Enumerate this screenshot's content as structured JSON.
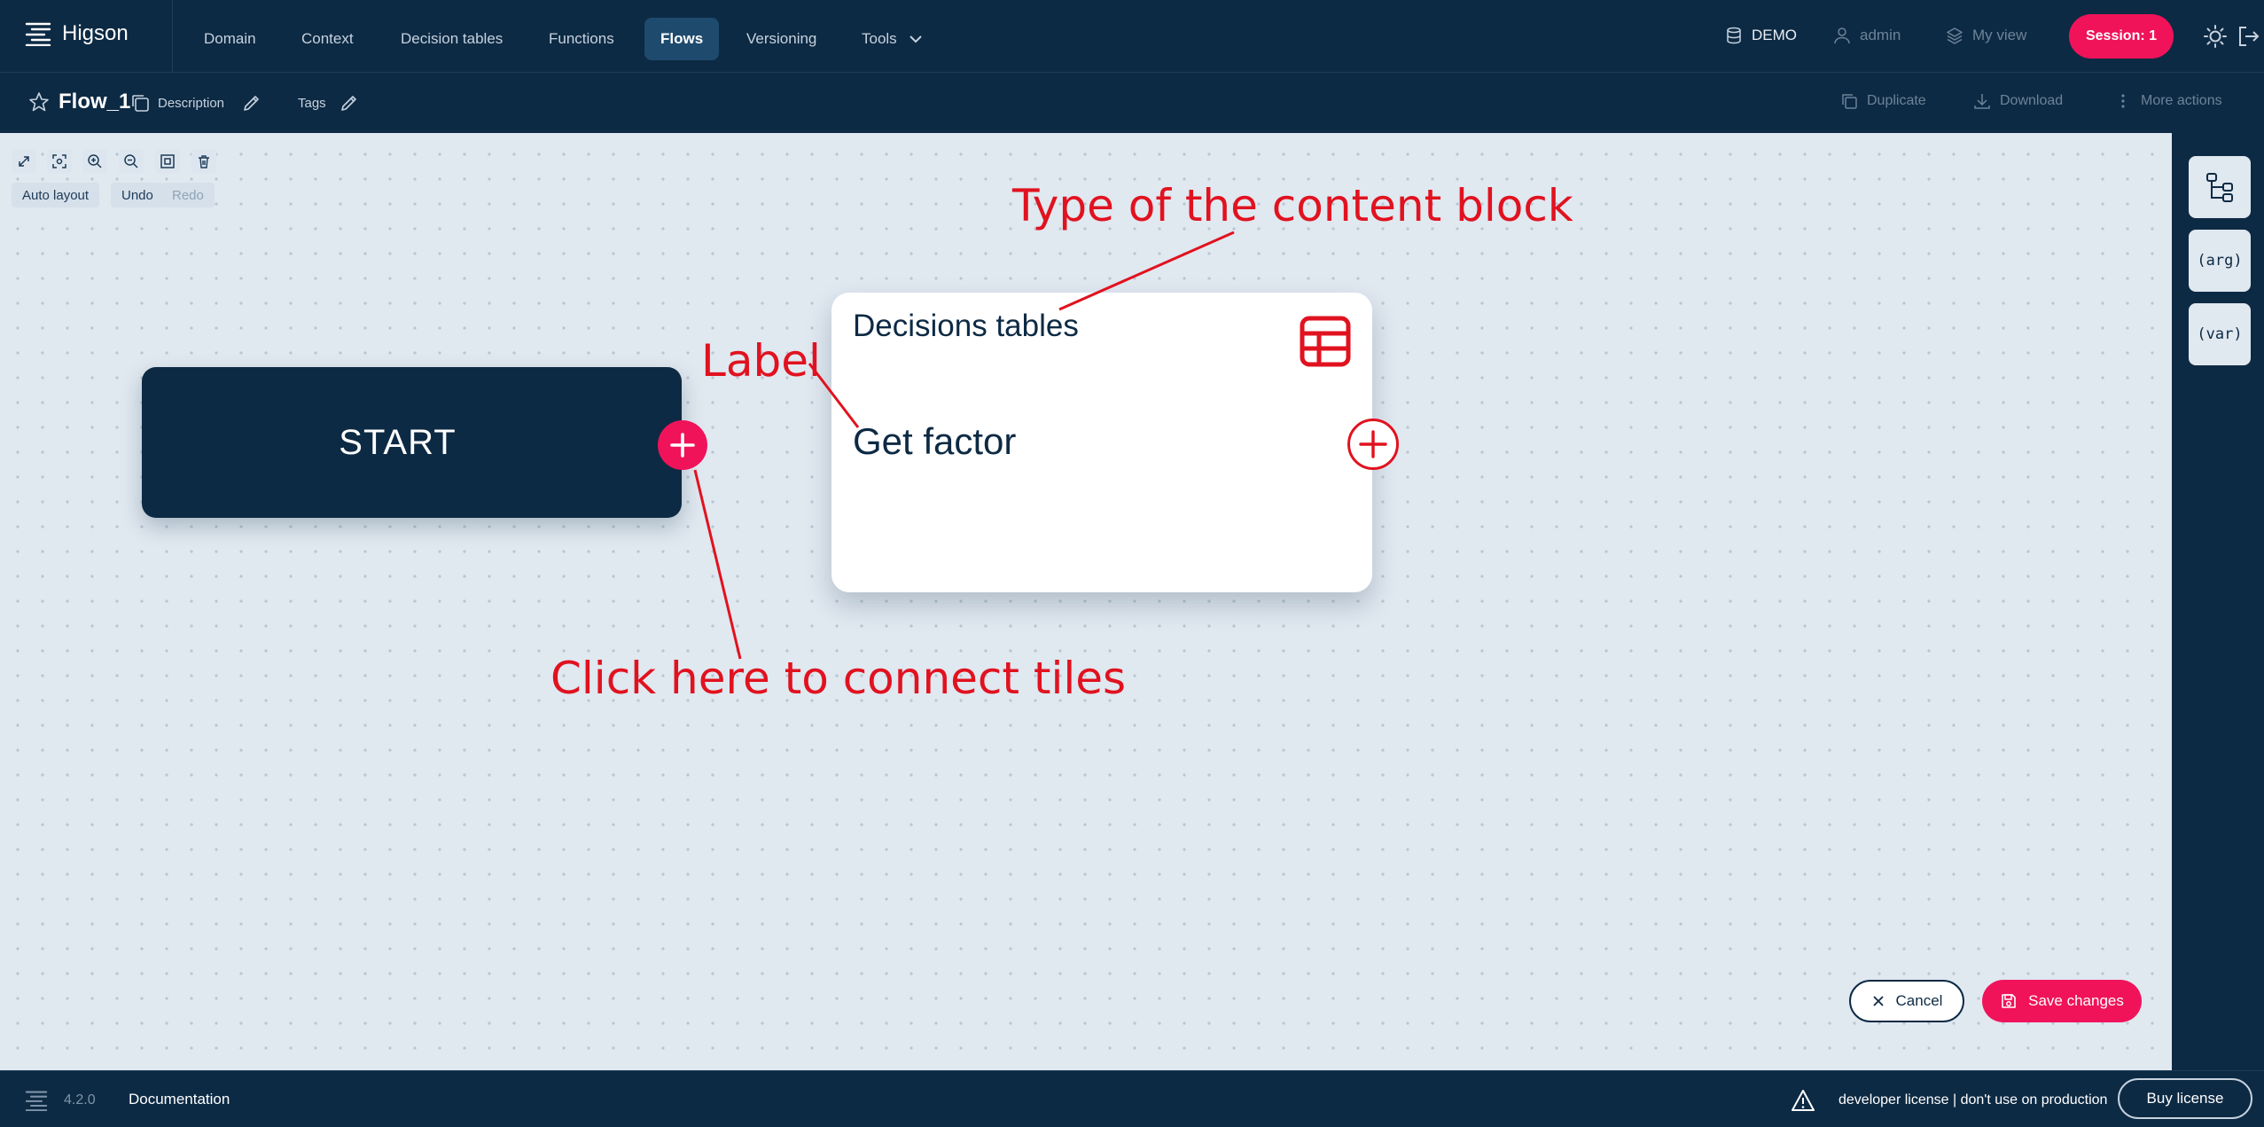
{
  "app": {
    "name": "Higson",
    "version": "4.2.0"
  },
  "nav": {
    "items": [
      {
        "label": "Domain"
      },
      {
        "label": "Context"
      },
      {
        "label": "Decision tables"
      },
      {
        "label": "Functions"
      },
      {
        "label": "Flows",
        "active": true
      },
      {
        "label": "Versioning"
      },
      {
        "label": "Tools"
      }
    ],
    "environment": "DEMO",
    "user": "admin",
    "my_view": "My view",
    "session": "Session: 1"
  },
  "flow": {
    "title": "Flow_1",
    "description_label": "Description",
    "tags_label": "Tags",
    "actions": {
      "duplicate": "Duplicate",
      "download": "Download",
      "more": "More actions"
    }
  },
  "canvas_controls": {
    "tools": [
      "expand-icon",
      "fit-view-icon",
      "zoom-in-icon",
      "zoom-out-icon",
      "select-frame-icon",
      "delete-icon"
    ],
    "auto_layout": "Auto layout",
    "undo": "Undo",
    "redo": "Redo"
  },
  "nodes": {
    "start": {
      "label": "START"
    },
    "content": {
      "type": "Decisions tables",
      "label": "Get factor"
    }
  },
  "annotations": {
    "type_note": "Type of the content block",
    "label_note": "Label",
    "connect_note": "Click here to connect tiles",
    "color": "#e1121f"
  },
  "side_panel": {
    "arg": "(arg)",
    "var": "(var)"
  },
  "buttons": {
    "cancel": "Cancel",
    "save": "Save changes"
  },
  "footer": {
    "documentation": "Documentation",
    "license_notice": "developer license | don't use on production",
    "buy_license": "Buy license"
  },
  "colors": {
    "navy": "#0d2a44",
    "accent": "#f0135a",
    "canvas": "#e0e8f0"
  }
}
